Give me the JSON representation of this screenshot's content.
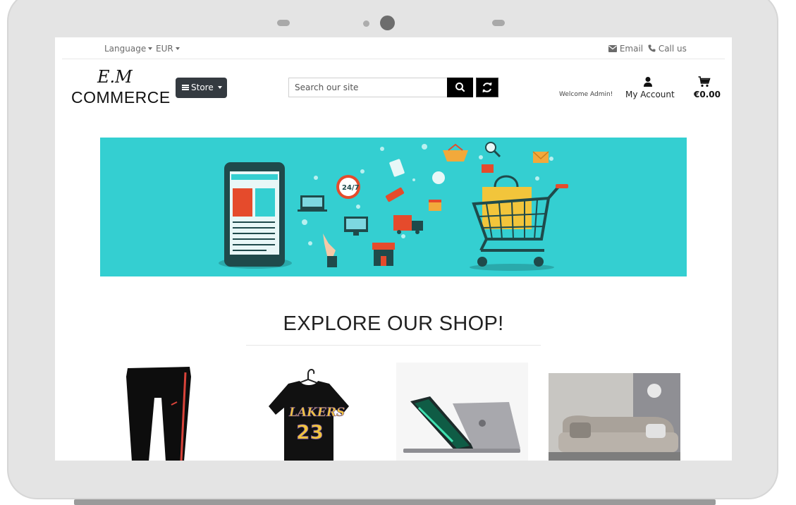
{
  "topbar": {
    "language_label": "Language",
    "currency_label": "EUR",
    "email_label": "Email",
    "call_label": "Call us"
  },
  "header": {
    "logo_line1": "E.M",
    "logo_line2": "COMMERCE",
    "store_label": "Store",
    "search_placeholder": "Search our site",
    "welcome_text": "Welcome Admin!",
    "account_label": "My Account",
    "cart_total": "€0.00"
  },
  "banner": {
    "background_color": "#34cfd1"
  },
  "main": {
    "headline": "EXPLORE OUR SHOP!",
    "products": [
      {
        "name": "track-pants",
        "icon": "pants-image"
      },
      {
        "name": "lakers-tshirt",
        "icon": "tshirt-image"
      },
      {
        "name": "laptop",
        "icon": "laptop-image"
      },
      {
        "name": "sofa",
        "icon": "sofa-image"
      }
    ]
  }
}
